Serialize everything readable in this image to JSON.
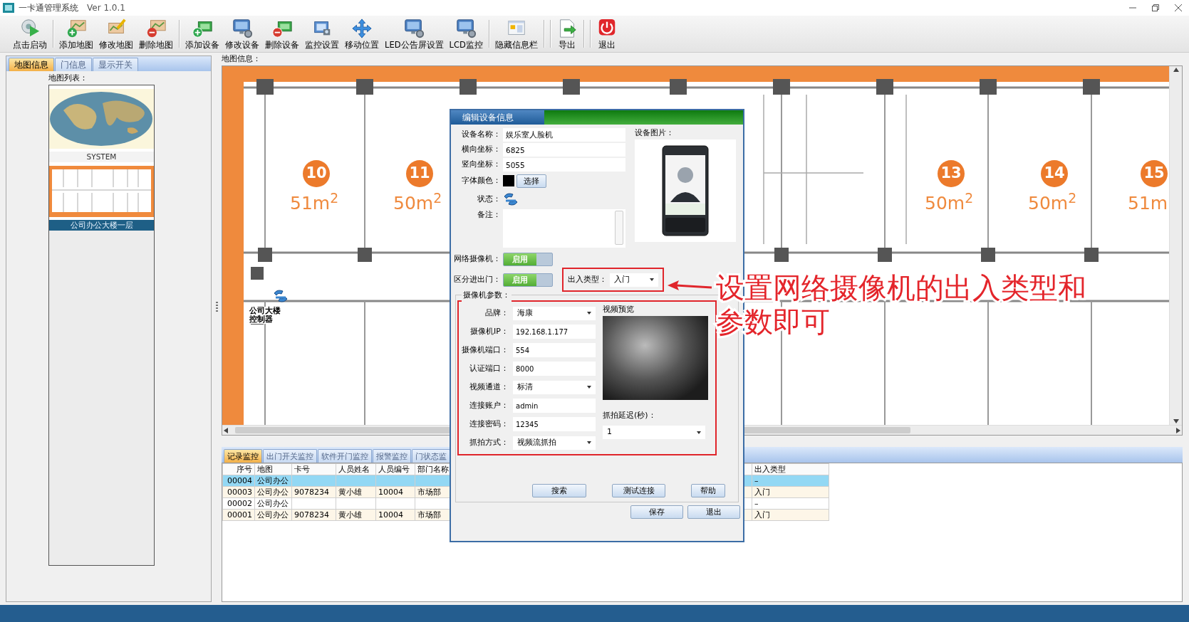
{
  "window": {
    "title": "一卡通管理系统",
    "version": "Ver 1.0.1"
  },
  "toolbar": [
    {
      "kind": "button",
      "label": "点击启动"
    },
    {
      "kind": "separator"
    },
    {
      "kind": "button",
      "label": "添加地图"
    },
    {
      "kind": "button",
      "label": "修改地图"
    },
    {
      "kind": "button",
      "label": "删除地图"
    },
    {
      "kind": "separator"
    },
    {
      "kind": "button",
      "label": "添加设备"
    },
    {
      "kind": "button",
      "label": "修改设备"
    },
    {
      "kind": "button",
      "label": "删除设备"
    },
    {
      "kind": "button",
      "label": "监控设置"
    },
    {
      "kind": "button",
      "label": "移动位置"
    },
    {
      "kind": "button",
      "label": "LED公告屏设置"
    },
    {
      "kind": "button",
      "label": "LCD监控"
    },
    {
      "kind": "separator"
    },
    {
      "kind": "button",
      "label": "隐藏信息栏"
    },
    {
      "kind": "separator"
    },
    {
      "kind": "separator"
    },
    {
      "kind": "button",
      "label": "导出"
    },
    {
      "kind": "separator"
    },
    {
      "kind": "separator"
    },
    {
      "kind": "button",
      "label": "退出"
    }
  ],
  "left_panel": {
    "tabs": [
      {
        "label": "地图信息",
        "selected": true
      },
      {
        "label": "门信息",
        "selected": false
      },
      {
        "label": "显示开关",
        "selected": false
      }
    ],
    "list_label": "地图列表：",
    "maps": [
      {
        "kind": "world",
        "name": "SYSTEM",
        "selected": false
      },
      {
        "kind": "floor",
        "name": "公司办公大楼一层",
        "selected": true
      }
    ]
  },
  "map_panel": {
    "label": "地图信息：",
    "rooms": [
      {
        "number": "10",
        "area": "51m$^{2}$"
      },
      {
        "number": "11",
        "area": "50m$^{2}$"
      },
      {
        "number": "13",
        "area": "50m$^{2}$"
      },
      {
        "number": "14",
        "area": "50m$^{2}$"
      },
      {
        "number": "15",
        "area": "51m"
      }
    ],
    "device": {
      "label": "公司大楼控制器"
    }
  },
  "bottom_panel": {
    "tabs": [
      {
        "label": "记录监控",
        "selected": true
      },
      {
        "label": "出门开关监控",
        "selected": false
      },
      {
        "label": "软件开门监控",
        "selected": false
      },
      {
        "label": "报警监控",
        "selected": false
      },
      {
        "label": "门状态监",
        "selected": false
      }
    ],
    "table": {
      "columns": [
        "序号",
        "地图",
        "卡号",
        "人员姓名",
        "人员编号",
        "部门名称",
        "出入类型"
      ],
      "rows": [
        {
          "cells": [
            "00004",
            "公司办公",
            null,
            null,
            null,
            null,
            "–"
          ],
          "selected": true
        },
        {
          "cells": [
            "00003",
            "公司办公",
            "9078234",
            "黄小雄",
            "10004",
            "市场部",
            "入门"
          ],
          "selected": false
        },
        {
          "cells": [
            "00002",
            "公司办公",
            null,
            null,
            null,
            null,
            "–"
          ],
          "selected": false
        },
        {
          "cells": [
            "00001",
            "公司办公",
            "9078234",
            "黄小雄",
            "10004",
            "市场部",
            "入门"
          ],
          "selected": false
        }
      ]
    }
  },
  "dialog": {
    "title": "编辑设备信息",
    "fields": [
      {
        "kind": "text",
        "label": "设备名称：",
        "value": "娱乐室人脸机"
      },
      {
        "kind": "text",
        "label": "横向坐标：",
        "value": "6825"
      },
      {
        "kind": "text",
        "label": "竖向坐标：",
        "value": "5055"
      },
      {
        "kind": "color",
        "label": "字体颜色：",
        "color": "#000000",
        "button": "选择"
      },
      {
        "kind": "status",
        "label": "状态："
      },
      {
        "kind": "textarea",
        "label": "备注："
      }
    ],
    "picture_label": "设备图片：",
    "switches": [
      {
        "label": "网络摄像机：",
        "text": "启用",
        "on": true
      },
      {
        "label": "区分进出门：",
        "text": "启用",
        "on": true
      }
    ],
    "direction": {
      "label": "出入类型：",
      "value": "入门",
      "highlighted": true
    },
    "camera": {
      "legend": "摄像机参数：",
      "highlighted": true,
      "fields": [
        {
          "kind": "select",
          "label": "品牌：",
          "value": "海康"
        },
        {
          "kind": "text",
          "label": "摄像机IP：",
          "value": "192.168.1.177"
        },
        {
          "kind": "text",
          "label": "摄像机端口：",
          "value": "554"
        },
        {
          "kind": "text",
          "label": "认证端口：",
          "value": "8000"
        },
        {
          "kind": "select",
          "label": "视频通道：",
          "value": "标清"
        },
        {
          "kind": "text",
          "label": "连接账户：",
          "value": "admin"
        },
        {
          "kind": "text",
          "label": "连接密码：",
          "value": "12345"
        },
        {
          "kind": "select",
          "label": "抓拍方式：",
          "value": "视频流抓拍"
        }
      ],
      "preview_label": "视频预览",
      "delay_label": "抓拍延迟(秒)：",
      "delay_value": "1"
    },
    "buttons": [
      "搜索",
      "测试连接",
      "帮助"
    ],
    "footer_buttons": [
      "保存",
      "退出"
    ]
  },
  "annotation": {
    "text": "设置网络摄像机的出入类型和参数即可"
  }
}
